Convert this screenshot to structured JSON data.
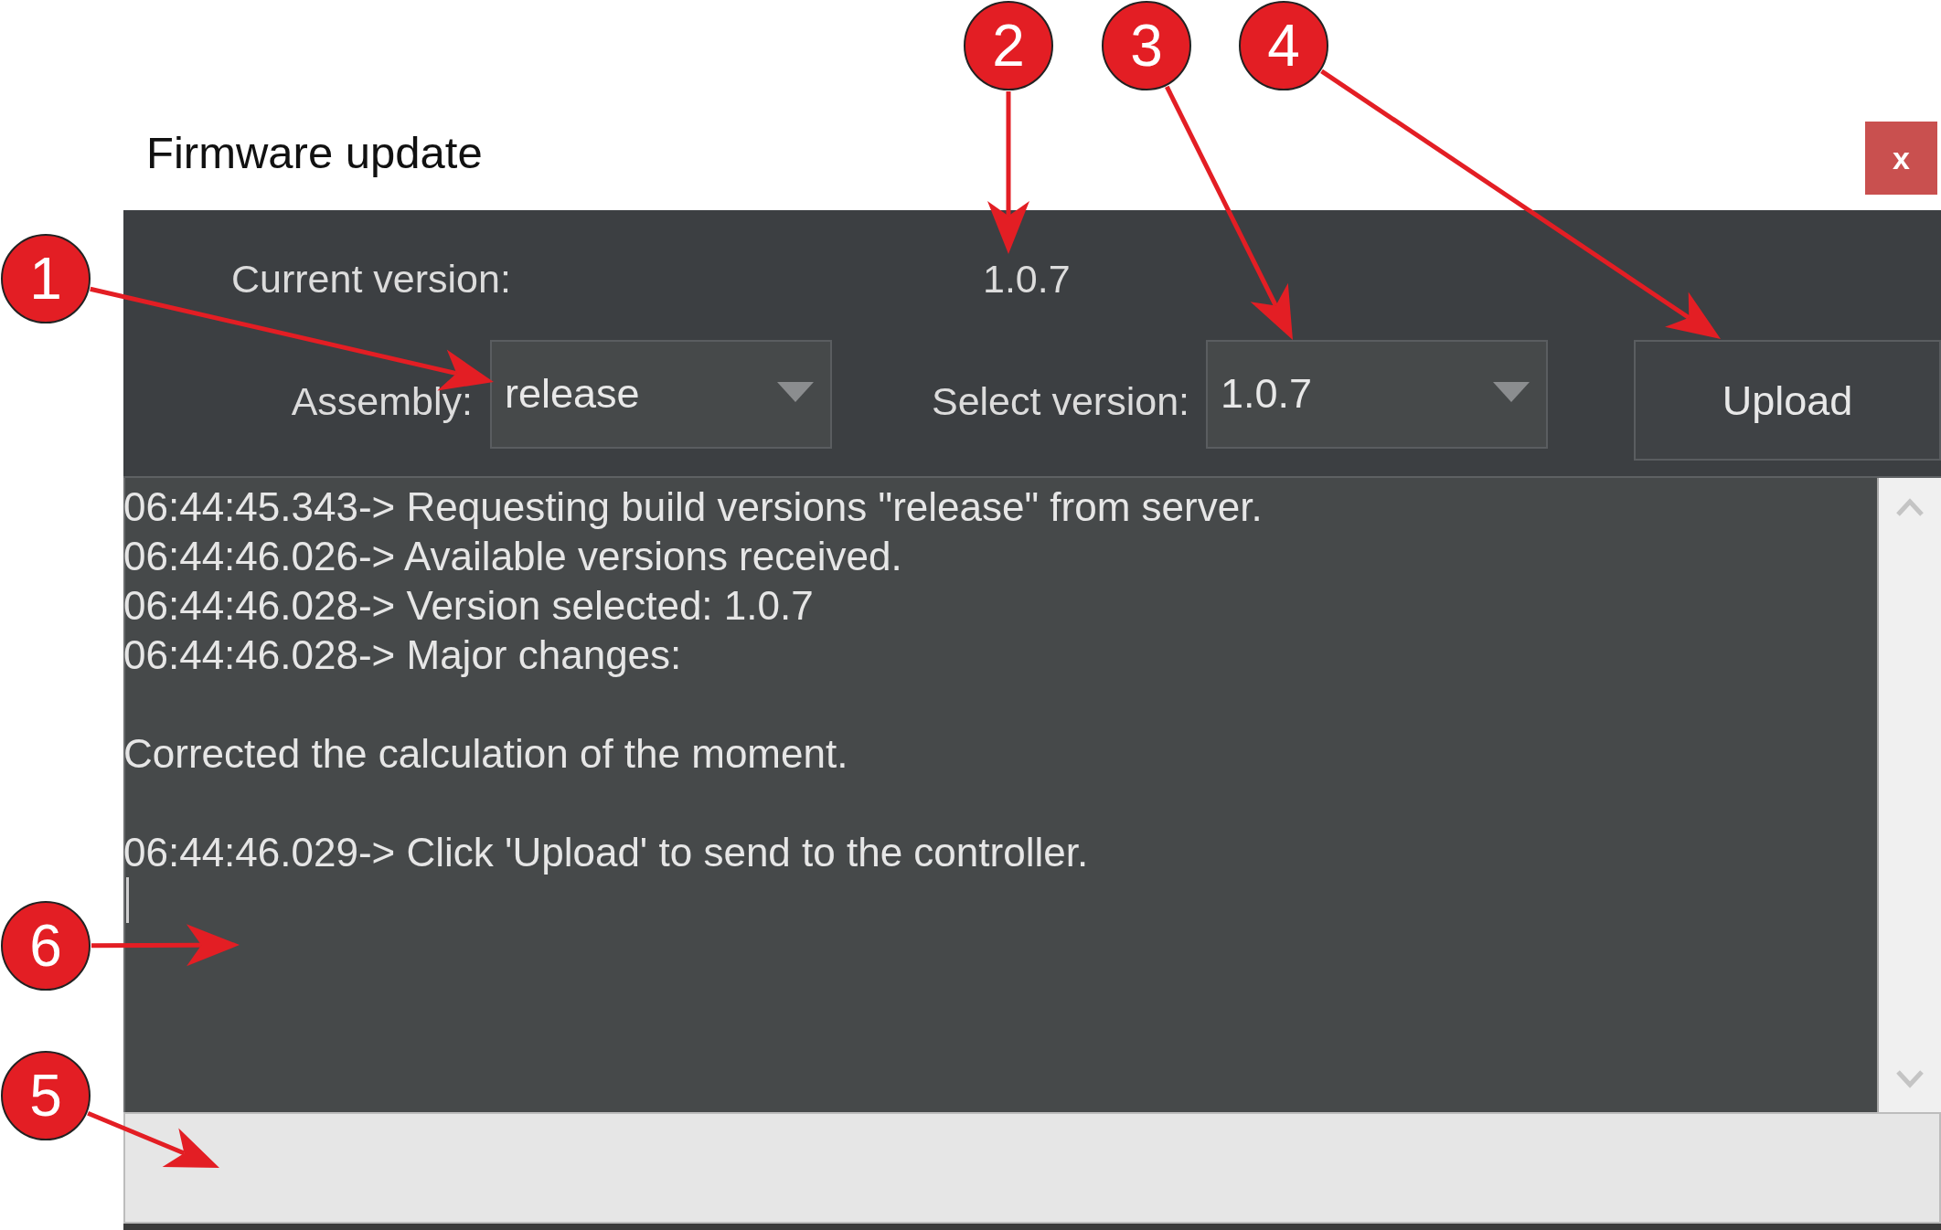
{
  "window": {
    "title": "Firmware update",
    "close_button": {
      "label": "x"
    }
  },
  "current_version": {
    "label": "Current version:",
    "value": "1.0.7"
  },
  "assembly": {
    "label": "Assembly:",
    "value": "release"
  },
  "select_version": {
    "label": "Select version:",
    "value": "1.0.7"
  },
  "upload_button": {
    "label": "Upload"
  },
  "log": {
    "blocks": [
      {
        "lines": [
          "06:44:45.343-> Requesting build versions \"release\" from server.",
          "06:44:46.026-> Available versions received.",
          "06:44:46.028-> Version selected: 1.0.7",
          "06:44:46.028-> Major changes:"
        ]
      },
      {
        "lines": [
          "Corrected the calculation of the moment."
        ]
      },
      {
        "lines": [
          "06:44:46.029-> Click 'Upload' to send to the controller."
        ]
      }
    ],
    "cursor_visible": true
  },
  "callouts": [
    {
      "label": "2"
    },
    {
      "label": "3"
    },
    {
      "label": "4"
    },
    {
      "label": "1"
    },
    {
      "label": "6"
    },
    {
      "label": "5"
    }
  ]
}
